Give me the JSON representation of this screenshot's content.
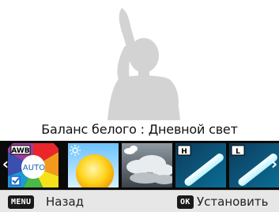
{
  "screen_title": "",
  "caption": {
    "label": "Баланс белого",
    "separator": " : ",
    "value": "Дневной свет"
  },
  "options": [
    {
      "name": "auto-white-balance",
      "badge": "AWB",
      "text": "AUTO",
      "selected": false
    },
    {
      "name": "daylight",
      "badge": "",
      "text": "",
      "selected": true
    },
    {
      "name": "cloudy",
      "badge": "",
      "text": "",
      "selected": false
    },
    {
      "name": "fluorescent-h",
      "badge": "H",
      "text": "",
      "selected": false
    },
    {
      "name": "fluorescent-l",
      "badge": "L",
      "text": "",
      "selected": false
    }
  ],
  "footer": {
    "menu_key": "MENU",
    "menu_label": "Назад",
    "ok_key": "OK",
    "ok_label": "Установить"
  },
  "colors": {
    "strip_bg": "#0a0a0a",
    "selection": "#1e63c8",
    "silhouette": "#d4d4d4",
    "footer_bg": "#e7e7e7"
  }
}
